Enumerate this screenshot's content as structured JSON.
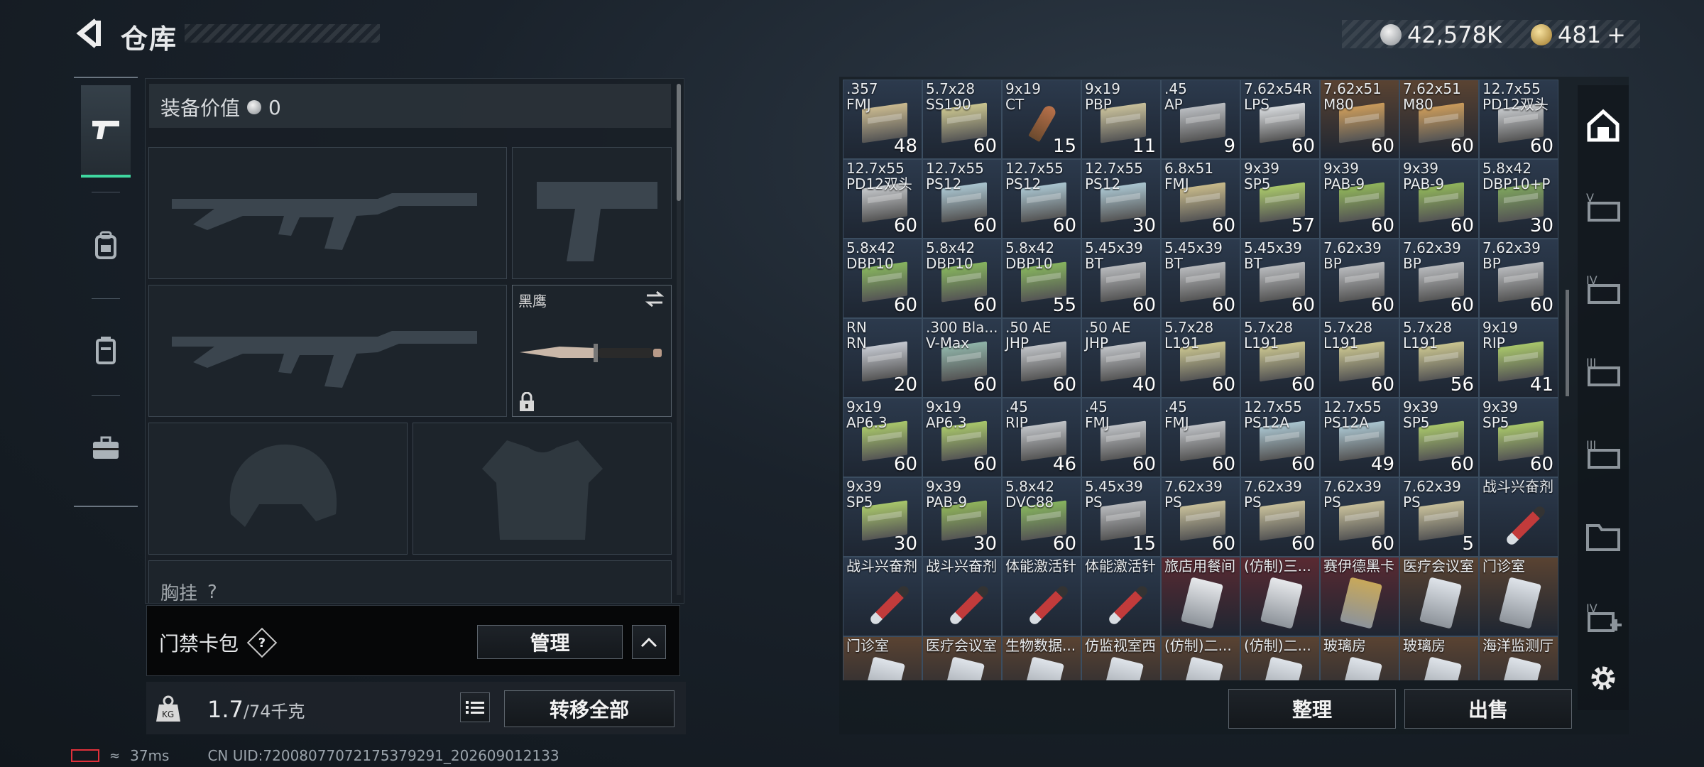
{
  "header": {
    "title": "仓库",
    "currency1": "42,578K",
    "currency2": "481",
    "currency2_plus": "+"
  },
  "equipment": {
    "value_label": "装备价值",
    "value": "0",
    "melee_name": "黑鹰",
    "chest_label": "胸挂",
    "chest_help": "?"
  },
  "keycard": {
    "label": "门禁卡包",
    "help": "?",
    "manage_label": "管理"
  },
  "footer": {
    "weight_current": "1.7",
    "weight_capacity": "/74千克",
    "kg_badge": "KG",
    "transfer_all_label": "转移全部",
    "organize_label": "整理",
    "sell_label": "出售"
  },
  "status": {
    "ping": "37ms",
    "uid": "CN UID:72008077072175379291_202609012133"
  },
  "colors": {
    "accent": "#3fd7a0",
    "cell_default": "#2c3a4d",
    "cell_gold": "#5a4332",
    "cell_red": "#5a2a32"
  },
  "inventory": {
    "rows": [
      [
        {
          "name": ".357\nFMJ",
          "count": "48",
          "art": "box",
          "box": "#c9b98f"
        },
        {
          "name": "5.7x28\nSS190",
          "count": "60",
          "art": "box",
          "box": "#c9c48f"
        },
        {
          "name": "9x19\nCT",
          "count": "15",
          "art": "bullet"
        },
        {
          "name": "9x19\nPBP",
          "count": "11",
          "art": "box",
          "box": "#c7bf9a"
        },
        {
          "name": ".45\nAP",
          "count": "9",
          "art": "box",
          "box": "#b9bcc0"
        },
        {
          "name": "7.62x54R\nLPS",
          "count": "60",
          "art": "box",
          "box": "#d6d9dc"
        },
        {
          "name": "7.62x51\nM80",
          "count": "60",
          "art": "box",
          "box": "#c99a5a",
          "bg": "gold"
        },
        {
          "name": "7.62x51\nM80",
          "count": "60",
          "art": "box",
          "box": "#c99a5a",
          "bg": "gold"
        },
        {
          "name": "12.7x55\nPD12双头",
          "count": "60",
          "art": "box",
          "box": "#c6c9cc"
        }
      ],
      [
        {
          "name": "12.7x55\nPD12双头",
          "count": "60",
          "art": "box",
          "box": "#c6c9cc"
        },
        {
          "name": "12.7x55\nPS12",
          "count": "60",
          "art": "box",
          "box": "#a9c4cf"
        },
        {
          "name": "12.7x55\nPS12",
          "count": "60",
          "art": "box",
          "box": "#a9c4cf"
        },
        {
          "name": "12.7x55\nPS12",
          "count": "30",
          "art": "box",
          "box": "#a9c4cf"
        },
        {
          "name": "6.8x51\nFMJ",
          "count": "60",
          "art": "box",
          "box": "#c7b98a"
        },
        {
          "name": "9x39\nSP5",
          "count": "57",
          "art": "box",
          "box": "#a8c66a"
        },
        {
          "name": "9x39\nPAB-9",
          "count": "60",
          "art": "box",
          "box": "#8fb35a"
        },
        {
          "name": "9x39\nPAB-9",
          "count": "60",
          "art": "box",
          "box": "#8fb35a"
        },
        {
          "name": "5.8x42\nDBP10+P",
          "count": "30",
          "art": "box",
          "box": "#7ea45e"
        }
      ],
      [
        {
          "name": "5.8x42\nDBP10",
          "count": "60",
          "art": "box",
          "box": "#86b35e"
        },
        {
          "name": "5.8x42\nDBP10",
          "count": "60",
          "art": "box",
          "box": "#86b35e"
        },
        {
          "name": "5.8x42\nDBP10",
          "count": "55",
          "art": "box",
          "box": "#86b35e"
        },
        {
          "name": "5.45x39\nBT",
          "count": "60",
          "art": "box",
          "box": "#b7b9bc"
        },
        {
          "name": "5.45x39\nBT",
          "count": "60",
          "art": "box",
          "box": "#b7b9bc"
        },
        {
          "name": "5.45x39\nBT",
          "count": "60",
          "art": "box",
          "box": "#b7b9bc"
        },
        {
          "name": "7.62x39\nBP",
          "count": "60",
          "art": "box",
          "box": "#b7b9bc"
        },
        {
          "name": "7.62x39\nBP",
          "count": "60",
          "art": "box",
          "box": "#b7b9bc"
        },
        {
          "name": "7.62x39\nBP",
          "count": "60",
          "art": "box",
          "box": "#b7b9bc"
        }
      ],
      [
        {
          "name": "RN\nRN",
          "count": "20",
          "art": "box",
          "box": "#c4c8d0"
        },
        {
          "name": ".300 Bla...\nV-Max",
          "count": "60",
          "art": "box",
          "box": "#8fb3a8"
        },
        {
          "name": ".50 AE\nJHP",
          "count": "60",
          "art": "box",
          "box": "#bfc2c6"
        },
        {
          "name": ".50 AE\nJHP",
          "count": "40",
          "art": "box",
          "box": "#bfc2c6"
        },
        {
          "name": "5.7x28\nL191",
          "count": "60",
          "art": "box",
          "box": "#c9c48f"
        },
        {
          "name": "5.7x28\nL191",
          "count": "60",
          "art": "box",
          "box": "#c9c48f"
        },
        {
          "name": "5.7x28\nL191",
          "count": "60",
          "art": "box",
          "box": "#c9c48f"
        },
        {
          "name": "5.7x28\nL191",
          "count": "56",
          "art": "box",
          "box": "#c9c48f"
        },
        {
          "name": "9x19\nRIP",
          "count": "41",
          "art": "box",
          "box": "#a8c66a"
        }
      ],
      [
        {
          "name": "9x19\nAP6.3",
          "count": "60",
          "art": "box",
          "box": "#a8c66a"
        },
        {
          "name": "9x19\nAP6.3",
          "count": "60",
          "art": "box",
          "box": "#a8c66a"
        },
        {
          "name": ".45\nRIP",
          "count": "46",
          "art": "box",
          "box": "#bfc2c6"
        },
        {
          "name": ".45\nFMJ",
          "count": "60",
          "art": "box",
          "box": "#bfc2c6"
        },
        {
          "name": ".45\nFMJ",
          "count": "60",
          "art": "box",
          "box": "#bfc2c6"
        },
        {
          "name": "12.7x55\nPS12A",
          "count": "60",
          "art": "box",
          "box": "#a9c4cf"
        },
        {
          "name": "12.7x55\nPS12A",
          "count": "49",
          "art": "box",
          "box": "#a9c4cf"
        },
        {
          "name": "9x39\nSP5",
          "count": "60",
          "art": "box",
          "box": "#a8c66a"
        },
        {
          "name": "9x39\nSP5",
          "count": "60",
          "art": "box",
          "box": "#a8c66a"
        }
      ],
      [
        {
          "name": "9x39\nSP5",
          "count": "30",
          "art": "box",
          "box": "#a8c66a"
        },
        {
          "name": "9x39\nPAB-9",
          "count": "30",
          "art": "box",
          "box": "#8fb35a"
        },
        {
          "name": "5.8x42\nDVC88",
          "count": "60",
          "art": "box",
          "box": "#86b35e"
        },
        {
          "name": "5.45x39\nPS",
          "count": "15",
          "art": "box",
          "box": "#b7b9bc"
        },
        {
          "name": "7.62x39\nPS",
          "count": "60",
          "art": "box",
          "box": "#c7bf9a"
        },
        {
          "name": "7.62x39\nPS",
          "count": "60",
          "art": "box",
          "box": "#c7bf9a"
        },
        {
          "name": "7.62x39\nPS",
          "count": "60",
          "art": "box",
          "box": "#c7bf9a"
        },
        {
          "name": "7.62x39\nPS",
          "count": "5",
          "art": "box",
          "box": "#c7bf9a"
        },
        {
          "name": "战斗兴奋剂",
          "count": "",
          "art": "inj"
        }
      ],
      [
        {
          "name": "战斗兴奋剂",
          "count": "",
          "art": "inj"
        },
        {
          "name": "战斗兴奋剂",
          "count": "",
          "art": "inj"
        },
        {
          "name": "体能激活针",
          "count": "",
          "art": "inj"
        },
        {
          "name": "体能激活针",
          "count": "",
          "art": "inj"
        },
        {
          "name": "旅店用餐间",
          "count": "",
          "art": "card",
          "box": "#e7e9ec",
          "bg": "red"
        },
        {
          "name": "(仿制)三...",
          "count": "",
          "art": "card",
          "box": "#e7e9ec",
          "bg": "red"
        },
        {
          "name": "赛伊德黑卡",
          "count": "",
          "art": "card",
          "box": "#c8a85a",
          "bg": "red"
        },
        {
          "name": "医疗会议室",
          "count": "",
          "art": "card",
          "box": "#dfe4ea",
          "bg": "gold"
        },
        {
          "name": "门诊室",
          "count": "",
          "art": "card",
          "box": "#dfe4ea",
          "bg": "gold"
        }
      ],
      [
        {
          "name": "门诊室",
          "count": "",
          "art": "card",
          "box": "#dfe4ea",
          "bg": "gold"
        },
        {
          "name": "医疗会议室",
          "count": "",
          "art": "card",
          "box": "#dfe4ea",
          "bg": "gold"
        },
        {
          "name": "生物数据...",
          "count": "",
          "art": "card",
          "box": "#dfe4ea",
          "bg": "gold"
        },
        {
          "name": "仿监视室西",
          "count": "",
          "art": "card",
          "box": "#dfe4ea",
          "bg": "gold"
        },
        {
          "name": "(仿制)二...",
          "count": "",
          "art": "card",
          "box": "#dfe4ea",
          "bg": "gold"
        },
        {
          "name": "(仿制)二...",
          "count": "",
          "art": "card",
          "box": "#dfe4ea",
          "bg": "gold"
        },
        {
          "name": "玻璃房",
          "count": "",
          "art": "card",
          "box": "#dfe4ea",
          "bg": "gold"
        },
        {
          "name": "玻璃房",
          "count": "",
          "art": "card",
          "box": "#dfe4ea",
          "bg": "gold"
        },
        {
          "name": "海洋监测厅",
          "count": "",
          "art": "card",
          "box": "#dfe4ea",
          "bg": "gold"
        }
      ]
    ]
  },
  "side_filters": [
    "safe-box-icon",
    "tier-v-case-icon",
    "tier-iv-case-icon",
    "tier-iii-case-icon",
    "tier-iii-case-icon",
    "folder-icon",
    "tier-iv-add-case-icon"
  ]
}
